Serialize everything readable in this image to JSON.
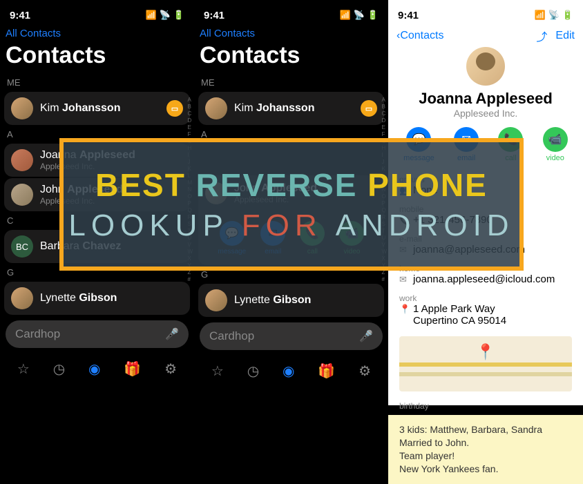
{
  "status": {
    "time": "9:41"
  },
  "nav": {
    "all_contacts": "All Contacts",
    "contacts_title": "Contacts",
    "detail_back": "Contacts",
    "edit": "Edit"
  },
  "sections": {
    "me": "ME",
    "a": "A",
    "c": "C",
    "g": "G"
  },
  "contacts": {
    "kim": {
      "first": "Kim",
      "last": "Johansson"
    },
    "joanna": {
      "first": "Joanna",
      "last": "Appleseed",
      "company": "Appleseed Inc."
    },
    "john": {
      "first": "John",
      "last": "Appleseed",
      "company": "Appleseed Inc."
    },
    "barbara": {
      "first": "Barbara",
      "last": "Chavez",
      "initials": "BC"
    },
    "lynette": {
      "first": "Lynette",
      "last": "Gibson"
    }
  },
  "search": {
    "placeholder": "Cardhop"
  },
  "actions": {
    "message": "message",
    "email": "email",
    "call": "call",
    "video": "video"
  },
  "detail": {
    "name": "Joanna Appleseed",
    "company": "Appleseed Inc.",
    "groups_label": "groups",
    "groups_value": "None",
    "mobile_label": "mobile",
    "mobile_value": "+1 321-456-7890",
    "email_label": "e-mail",
    "email_value": "joanna@appleseed.com",
    "home_label": "home",
    "home_value": "joanna.appleseed@icloud.com",
    "work_label": "work",
    "work_addr1": "1 Apple Park Way",
    "work_addr2": "Cupertino CA 95014",
    "birthday_label": "birthday",
    "notes_l1": "3 kids: Matthew, Barbara, Sandra",
    "notes_l2": "Married to John.",
    "notes_l3": "Team player!",
    "notes_l4": "New York Yankees fan."
  },
  "alpha_index": [
    "A",
    "B",
    "C",
    "D",
    "E",
    "F",
    "G",
    "H",
    "I",
    "J",
    "K",
    "L",
    "M",
    "N",
    "O",
    "P",
    "Q",
    "R",
    "S",
    "T",
    "U",
    "V",
    "W",
    "X",
    "Y",
    "Z",
    "#"
  ],
  "overlay": {
    "w1": "BEST",
    "w2": "REVERSE",
    "w3": "PHONE",
    "w4": "LOOKUP",
    "w5": "FOR",
    "w6": "ANDROID"
  }
}
